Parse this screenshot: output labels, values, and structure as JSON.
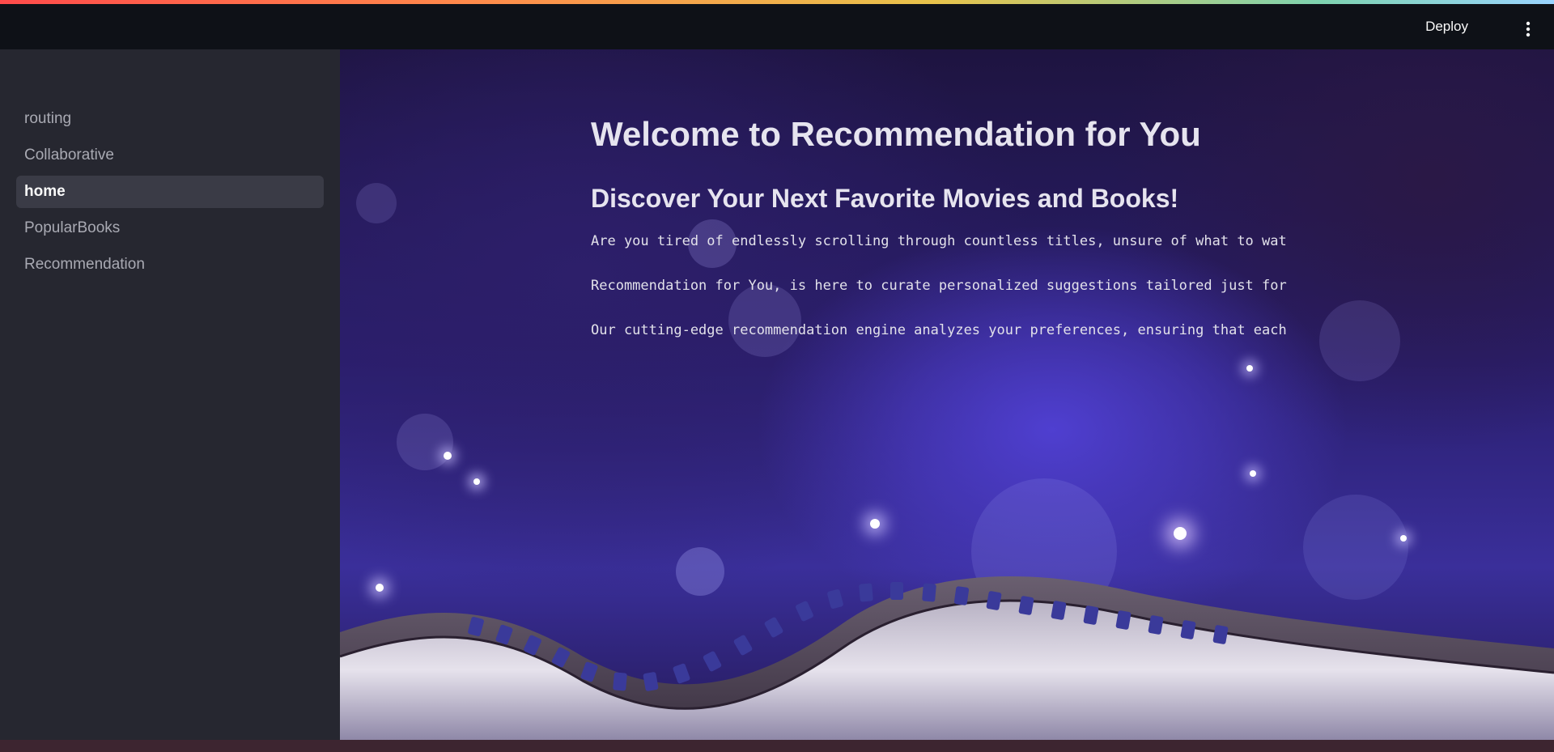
{
  "header": {
    "deploy_label": "Deploy",
    "menu_icon": "vertical-dots-icon"
  },
  "sidebar": {
    "items": [
      {
        "label": "routing",
        "active": false
      },
      {
        "label": "Collaborative",
        "active": false
      },
      {
        "label": "home",
        "active": true
      },
      {
        "label": "PopularBooks",
        "active": false
      },
      {
        "label": "Recommendation",
        "active": false
      }
    ]
  },
  "main": {
    "title": "Welcome to Recommendation for You",
    "subtitle": "Discover Your Next Favorite Movies and Books!",
    "paragraphs": [
      "Are you tired of endlessly scrolling through countless titles, unsure of what to wat",
      "Recommendation for You, is here to curate personalized suggestions tailored just for",
      "Our cutting-edge recommendation engine analyzes your preferences, ensuring that each"
    ],
    "background": "film-strip-bokeh-image"
  },
  "colors": {
    "app_bg": "#0e1117",
    "sidebar_bg": "#262730",
    "active_item_bg": "#3a3b46",
    "text_primary": "#fafafa",
    "text_muted": "#a9aab3"
  }
}
